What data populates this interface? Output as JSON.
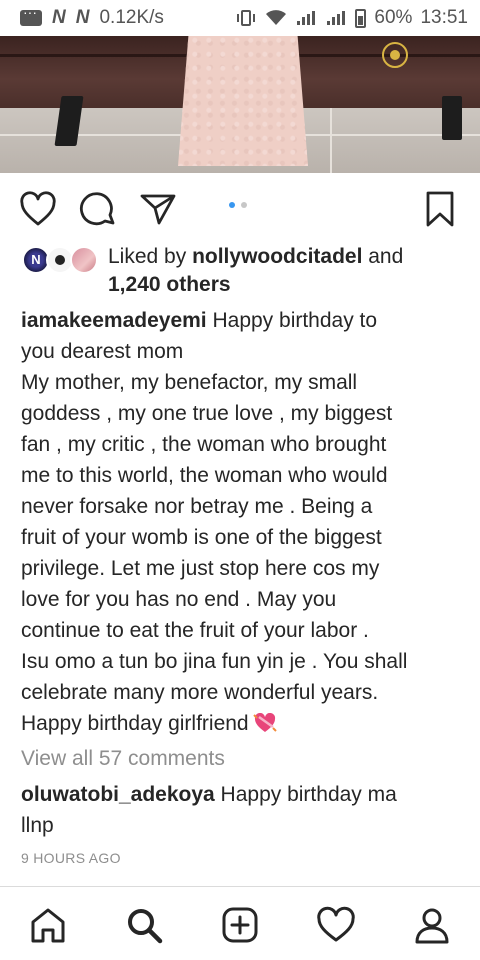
{
  "status_bar": {
    "carrier_1": "N",
    "carrier_2": "N",
    "speed": "0.12K/s",
    "battery": "60%",
    "time": "13:51"
  },
  "post": {
    "carousel": {
      "total_slides": 2,
      "active_slide": 1
    },
    "likes": {
      "prefix": "Liked by ",
      "user": "nollywoodcitadel",
      "joiner": " and",
      "others": "1,240 others"
    },
    "caption": {
      "username": "iamakeemadeyemi",
      "lines": [
        " Happy birthday to",
        "you dearest mom",
        "My mother,  my benefactor,  my small",
        "goddess , my one true love , my biggest",
        "fan , my critic , the woman  who brought",
        "me to this world,  the woman who would",
        "never forsake nor betray me . Being a",
        "fruit of your womb is one of the biggest",
        "privilege.  Let me just stop here cos my",
        "love for you has no end . May you",
        "continue to eat the fruit of your labor .",
        "Isu omo a tun bo jina fun yin je . You shall",
        "celebrate many more wonderful years.",
        "Happy birthday girlfriend"
      ],
      "emoji": "heart-with-ribbon-icon"
    },
    "view_all_comments": "View all 57 comments",
    "comment": {
      "username": "oluwatobi_adekoya",
      "text_line1": " Happy birthday ma",
      "text_line2": "llnp"
    },
    "timestamp": "9 HOURS AGO"
  },
  "icons": {
    "like": "heart-outline-icon",
    "comment": "comment-bubble-icon",
    "share": "paper-plane-icon",
    "save": "bookmark-icon"
  },
  "nav": {
    "items": [
      "home-icon",
      "search-icon",
      "new-post-icon",
      "activity-heart-icon",
      "profile-icon"
    ]
  },
  "colors": {
    "accent": "#3897f0",
    "text": "#262626",
    "muted": "#8e8e8e"
  }
}
